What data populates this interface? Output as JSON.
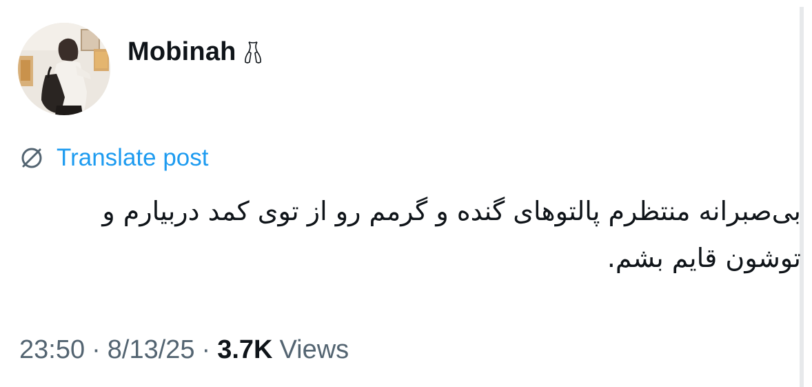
{
  "author": {
    "display_name": "Mobinah",
    "name_emoji": "ballet-shoes-emoji",
    "avatar": "profile-photo-avatar"
  },
  "translate": {
    "icon": "globe-icon",
    "label": "Translate post"
  },
  "post": {
    "text": "بی‌صبرانه منتظرم پالتوهای گنده و گرمم رو از توی کمد دربیارم و توشون قایم بشم."
  },
  "meta": {
    "time": "23:50",
    "separator": "·",
    "date": "8/13/25",
    "views_count": "3.7K",
    "views_label": "Views"
  },
  "colors": {
    "link": "#1d9bf0",
    "secondary_text": "#536471",
    "primary_text": "#0f1419",
    "divider": "#e7e9eb"
  }
}
